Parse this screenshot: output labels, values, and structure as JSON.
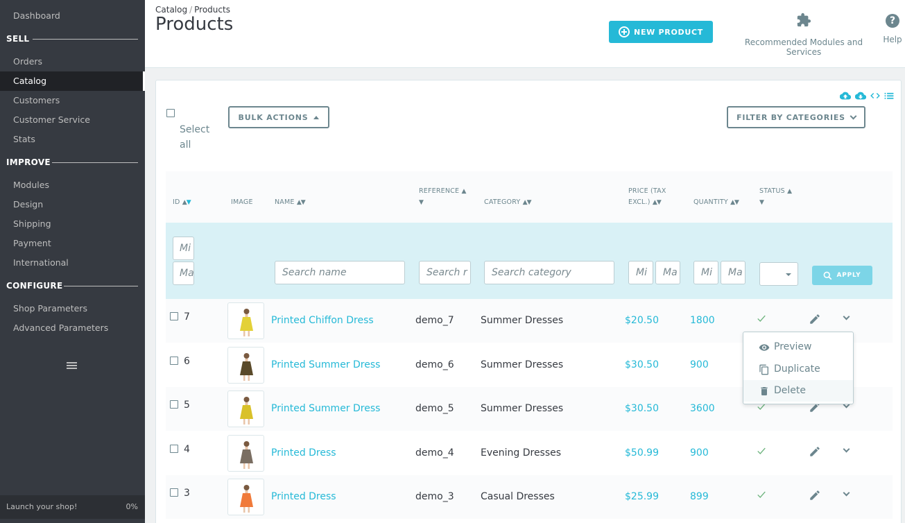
{
  "sidebar": {
    "dashboard": "Dashboard",
    "sections": [
      {
        "title": "SELL",
        "items": [
          "Orders",
          "Catalog",
          "Customers",
          "Customer Service",
          "Stats"
        ]
      },
      {
        "title": "IMPROVE",
        "items": [
          "Modules",
          "Design",
          "Shipping",
          "Payment",
          "International"
        ]
      },
      {
        "title": "CONFIGURE",
        "items": [
          "Shop Parameters",
          "Advanced Parameters"
        ]
      }
    ],
    "active_item": "Catalog",
    "launch_label": "Launch your shop!",
    "launch_progress": "0%"
  },
  "header": {
    "breadcrumb_1": "Catalog",
    "breadcrumb_sep": "/",
    "breadcrumb_2": "Products",
    "title": "Products",
    "new_product": "NEW PRODUCT",
    "recommended": "Recommended Modules and Services",
    "help": "Help"
  },
  "toolbar": {
    "select_all": "Select all",
    "bulk_actions": "BULK ACTIONS",
    "filter_categories": "FILTER BY CATEGORIES"
  },
  "columns": {
    "id": "ID",
    "image": "IMAGE",
    "name": "NAME",
    "reference": "REFERENCE",
    "category": "CATEGORY",
    "price_1": "PRICE (TAX",
    "price_2": "EXCL.)",
    "quantity": "QUANTITY",
    "status": "STATUS"
  },
  "filters": {
    "id_min": "Mi",
    "id_max": "Ma",
    "name": "Search name",
    "reference": "Search r",
    "category": "Search category",
    "price_min": "Mi",
    "price_max": "Ma",
    "qty_min": "Mi",
    "qty_max": "Ma",
    "apply": "APPLY"
  },
  "products": [
    {
      "id": "7",
      "name": "Printed Chiffon Dress",
      "reference": "demo_7",
      "category": "Summer Dresses",
      "price": "$20.50",
      "quantity": "1800",
      "dress_color": "#e3d138"
    },
    {
      "id": "6",
      "name": "Printed Summer Dress",
      "reference": "demo_6",
      "category": "Summer Dresses",
      "price": "$30.50",
      "quantity": "900",
      "dress_color": "#5a4a2a"
    },
    {
      "id": "5",
      "name": "Printed Summer Dress",
      "reference": "demo_5",
      "category": "Summer Dresses",
      "price": "$30.50",
      "quantity": "3600",
      "dress_color": "#d9c12a"
    },
    {
      "id": "4",
      "name": "Printed Dress",
      "reference": "demo_4",
      "category": "Evening Dresses",
      "price": "$50.99",
      "quantity": "900",
      "dress_color": "#7a6e62"
    },
    {
      "id": "3",
      "name": "Printed Dress",
      "reference": "demo_3",
      "category": "Casual Dresses",
      "price": "$25.99",
      "quantity": "899",
      "dress_color": "#f07a3a"
    }
  ],
  "row_menu": {
    "preview": "Preview",
    "duplicate": "Duplicate",
    "delete": "Delete"
  }
}
